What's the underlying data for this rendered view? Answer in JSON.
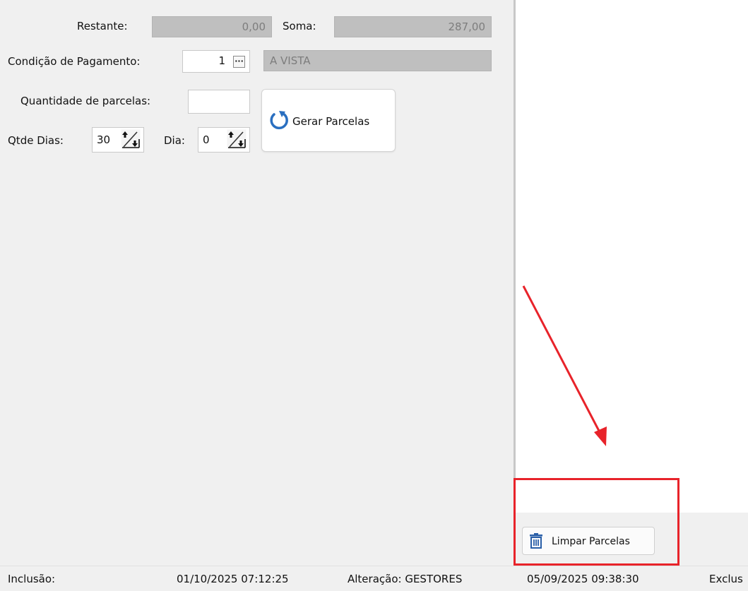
{
  "form": {
    "restante_label": "Restante:",
    "restante_value": "0,00",
    "soma_label": "Soma:",
    "soma_value": "287,00",
    "condicao_label": "Condição de Pagamento:",
    "condicao_code": "1",
    "condicao_lookup_label": "···",
    "condicao_desc": "A VISTA",
    "quantidade_label": "Quantidade de parcelas:",
    "quantidade_value": "",
    "qtde_dias_label": "Qtde Dias:",
    "qtde_dias_value": "30",
    "dia_label": "Dia:",
    "dia_value": "0",
    "gerar_label": "Gerar Parcelas"
  },
  "actions": {
    "limpar_label": "Limpar Parcelas"
  },
  "status_bar": {
    "inclusao_label": "Inclusão:",
    "inclusao_value": "01/10/2025 07:12:25",
    "alteracao_label": "Alteração: GESTORES",
    "alteracao_value": "05/09/2025 09:38:30",
    "exclusao_label_partial": "Exclus"
  },
  "colors": {
    "annotation_red": "#e8232a",
    "icon_blue": "#2a6fc0",
    "readonly_gray": "#bfbfbf"
  },
  "icons": [
    "ellipsis-icon",
    "spin-up-down-icon",
    "refresh-icon",
    "trash-icon",
    "arrow-annotation"
  ]
}
